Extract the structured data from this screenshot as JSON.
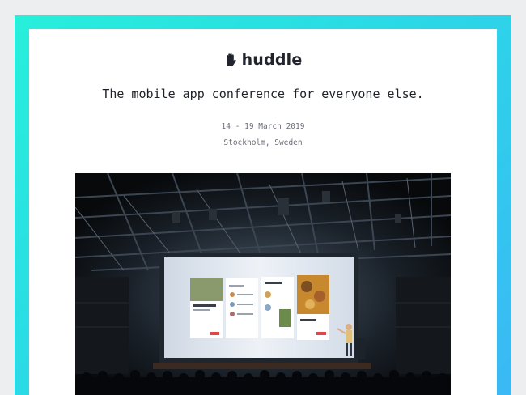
{
  "brand": {
    "name": "huddle",
    "logo_icon": "waving-hand-icon"
  },
  "header": {
    "tagline": "The mobile app conference for everyone else.",
    "dates": "14 - 19 March 2019",
    "location": "Stockholm, Sweden"
  },
  "hero_image": {
    "description_icon": "conference-stage-photo",
    "screen_cards": [
      {
        "title": "Loft with Open-Plan Plan and Kitchen"
      },
      {
        "title": ""
      },
      {
        "title": "Los Angeles"
      },
      {
        "title": "Pop-up Restaurant Tour"
      }
    ]
  },
  "colors": {
    "frame_gradient_start": "#26f0da",
    "frame_gradient_end": "#3bb8f5",
    "text_dark": "#23252e",
    "text_muted": "#6b6e75"
  }
}
